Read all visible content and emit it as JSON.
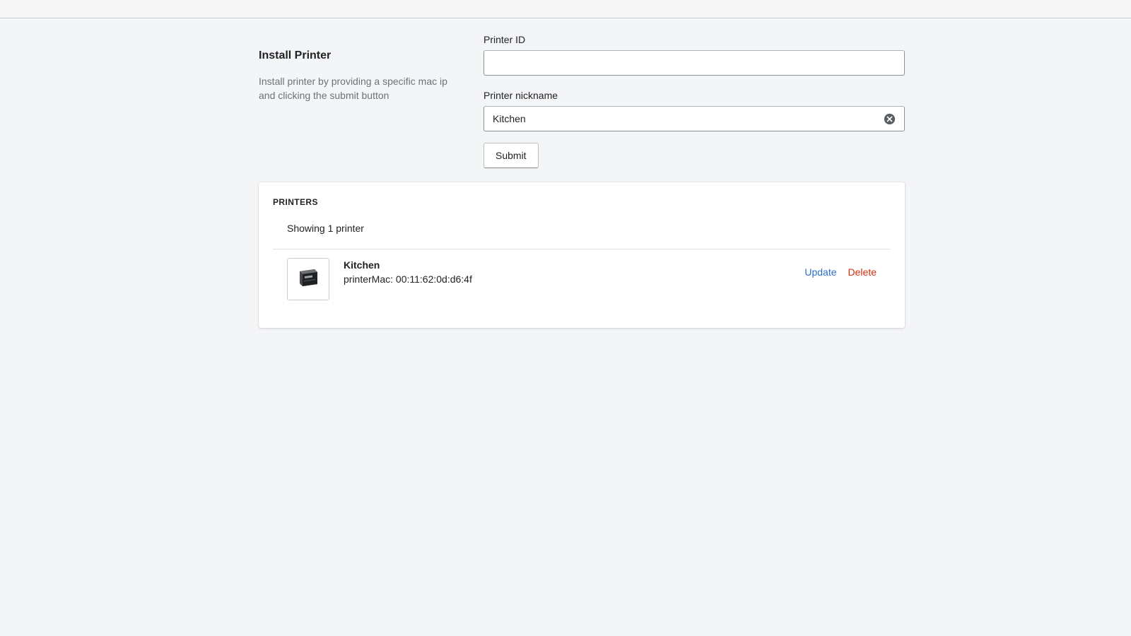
{
  "install_section": {
    "title": "Install Printer",
    "description": "Install printer by providing a specific mac ip and clicking the submit button"
  },
  "form": {
    "printer_id": {
      "label": "Printer ID",
      "value": ""
    },
    "printer_nickname": {
      "label": "Printer nickname",
      "value": "Kitchen"
    },
    "submit_label": "Submit",
    "clear_icon": "circle-x-icon"
  },
  "printers_card": {
    "title": "PRINTERS",
    "count_text": "Showing 1 printer",
    "items": [
      {
        "name": "Kitchen",
        "mac": "printerMac: 00:11:62:0d:d6:4f",
        "thumbnail_icon": "printer-icon",
        "update_label": "Update",
        "delete_label": "Delete"
      }
    ]
  },
  "colors": {
    "link": "#2c6ecb",
    "destructive": "#d72c0d",
    "subdued_text": "#6d7175",
    "background": "#f4f5f7"
  }
}
